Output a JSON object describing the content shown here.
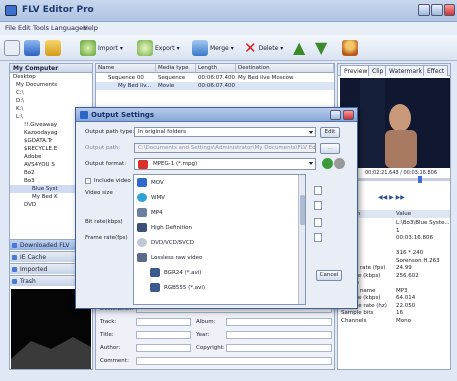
{
  "app": {
    "title": "FLV Editor Pro"
  },
  "menu": [
    "File",
    "Edit",
    "Tools",
    "Languages",
    "Help"
  ],
  "toolbar": {
    "import": "Import",
    "export": "Export",
    "merge": "Merge",
    "delete": "Delete"
  },
  "left_panel": {
    "header": "My Computer",
    "tree": [
      "Desktop",
      "My Documents",
      "C:\\",
      "D:\\",
      "K:\\",
      "L:\\",
      "!!.Giveaway",
      "Kazoodayag",
      "$GDATA.Tr",
      "$RECYCLE.E",
      "Adobe",
      "AVS4YOU S",
      "Bo2",
      "Bo3",
      "Blue Syst",
      "My Bed K",
      "DVD"
    ],
    "buttons": [
      "Downloaded FLV",
      "IE Cache",
      "Imported",
      "Trash"
    ]
  },
  "center": {
    "columns": [
      "Name",
      "Media type",
      "Length",
      "Destination"
    ],
    "rows": [
      {
        "name": "Sequence 00",
        "type": "Sequence",
        "length": "00:06:07.400",
        "dest": "My Bed live Moscow"
      },
      {
        "name": "My Bed liv...",
        "type": "Movie",
        "length": "00:06:07.400",
        "dest": ""
      }
    ]
  },
  "bottom_fields": {
    "destination": "Destination:",
    "track": "Track:",
    "title": "Title:",
    "author": "Author:",
    "comment": "Comment:",
    "album": "Album:",
    "year": "Year:",
    "copyright": "Copyright:"
  },
  "right_panel": {
    "tabs": [
      "Preview",
      "Clip",
      "Watermark",
      "Effect"
    ],
    "time": "00:02:21.643 / 00:03:16.806",
    "props_header": {
      "key": "mation",
      "value": "Value"
    },
    "props": [
      [
        "",
        "L:\\Bo3\\Blue Syste..."
      ],
      [
        "",
        "1"
      ],
      [
        "",
        "00:03:16.806"
      ],
      [
        "",
        ""
      ],
      [
        "",
        "316 * 240"
      ],
      [
        "",
        "Sorenson H.263"
      ],
      [
        "Frame rate (fps)",
        "24.99"
      ],
      [
        "Bit rate (kbps)",
        "256.602"
      ],
      [
        "Audio",
        ""
      ],
      [
        "Codec name",
        "MP3"
      ],
      [
        "Bit rate (kbps)",
        "64.014"
      ],
      [
        "Sample rate (hz)",
        "22.050"
      ],
      [
        "Sample bits",
        "16"
      ],
      [
        "Channels",
        "Mono"
      ]
    ]
  },
  "dialog": {
    "title": "Output Settings",
    "path_type_label": "Output path type:",
    "path_type_value": "In original folders",
    "edit": "Edit",
    "output_path_label": "Output path:",
    "output_path_value": "C:\\Documents and Settings\\Administrator\\My Documents\\FLV Edit",
    "format_label": "Output format:",
    "format_value": "MPEG-1 (*.mpg)",
    "include_video": "Include video",
    "video_size": "Video size",
    "bit_rate": "Bit rate(kbps)",
    "frame_rate": "Frame rate(fps)",
    "cancel": "Cancel",
    "formats": [
      "MOV",
      "WMV",
      "MP4",
      "High Definition",
      "DVD/VCD/SVCD",
      "Lossless raw video",
      "BGR24 (*.avi)",
      "RGB555 (*.avi)"
    ]
  },
  "colors": {
    "accent": "#3b6fd0",
    "titlebar": "#aec3e2",
    "dialog_border": "#3d5f9a"
  }
}
